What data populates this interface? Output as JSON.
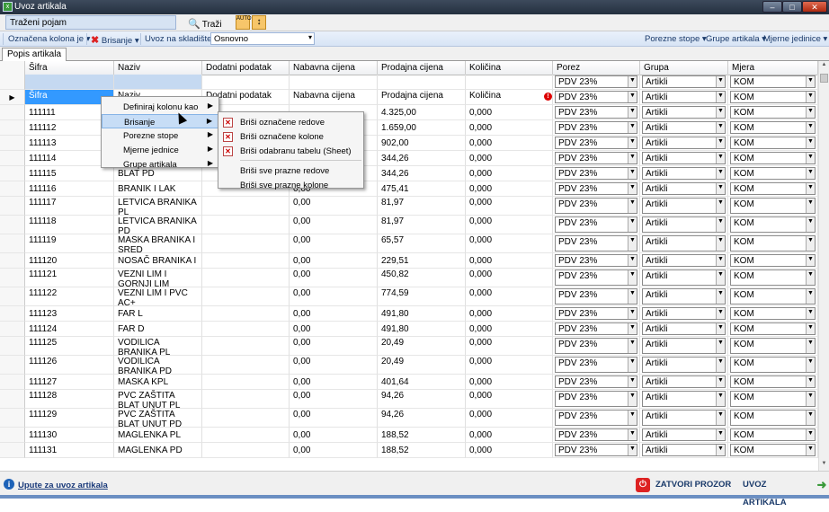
{
  "window": {
    "title": "Uvoz artikala",
    "min": "–",
    "max": "□",
    "close": "✕",
    "app_icon": "excel-icon"
  },
  "search": {
    "placeholder": "Traženi pojam",
    "button": "Traži",
    "tb1": "AUTO",
    "tb2": "↕"
  },
  "toolbar": {
    "oznacena_kolona": "Označena kolona je ▾",
    "brisanje": "Brisanje ▾",
    "uvoz_na_skladiste": "Uvoz na skladište :",
    "skladiste_value": "Osnovno",
    "porezne_stope": "Porezne stope ▾",
    "grupe_artikala": "Grupe artikala ▾",
    "mjerne_jedinice": "Mjerne jedinice ▾"
  },
  "tab": "Popis artikala",
  "columns": [
    "Šifra",
    "Naziv",
    "Dodatni podatak",
    "Nabavna cijena",
    "Prodajna cijena",
    "Količina",
    "Porez",
    "Grupa",
    "Mjera"
  ],
  "blank_row": {
    "porez": "PDV 23%",
    "grupa": "Artikli",
    "mjera": "KOM"
  },
  "header_row": [
    "Šifra",
    "Naziv",
    "Dodatni podatak",
    "Nabavna cijena",
    "Prodajna cijena",
    "Količina",
    "PDV 23%",
    "Artikli",
    "KOM"
  ],
  "rows": [
    {
      "sifra": "111111",
      "naziv": "",
      "dodatni": "",
      "nabavna": "",
      "prodajna": "4.325,00",
      "kolicina": "0,000",
      "porez": "PDV 23%",
      "grupa": "Artikli",
      "mjera": "KOM"
    },
    {
      "sifra": "111112",
      "naziv": "",
      "dodatni": "",
      "nabavna": "",
      "prodajna": "1.659,00",
      "kolicina": "0,000",
      "porez": "PDV 23%",
      "grupa": "Artikli",
      "mjera": "KOM"
    },
    {
      "sifra": "111113",
      "naziv": "",
      "dodatni": "",
      "nabavna": "",
      "prodajna": "902,00",
      "kolicina": "0,000",
      "porez": "PDV 23%",
      "grupa": "Artikli",
      "mjera": "KOM"
    },
    {
      "sifra": "111114",
      "naziv": "",
      "dodatni": "",
      "nabavna": "",
      "prodajna": "344,26",
      "kolicina": "0,000",
      "porez": "PDV 23%",
      "grupa": "Artikli",
      "mjera": "KOM"
    },
    {
      "sifra": "111115",
      "naziv": "BLAT PD",
      "dodatni": "",
      "nabavna": "",
      "prodajna": "344,26",
      "kolicina": "0,000",
      "porez": "PDV 23%",
      "grupa": "Artikli",
      "mjera": "KOM"
    },
    {
      "sifra": "111116",
      "naziv": "BRANIK I LAK",
      "dodatni": "",
      "nabavna": "0,00",
      "prodajna": "475,41",
      "kolicina": "0,000",
      "porez": "PDV 23%",
      "grupa": "Artikli",
      "mjera": "KOM"
    },
    {
      "sifra": "111117",
      "naziv": "LETVICA BRANIKA PL",
      "dodatni": "",
      "nabavna": "0,00",
      "prodajna": "81,97",
      "kolicina": "0,000",
      "porez": "PDV 23%",
      "grupa": "Artikli",
      "mjera": "KOM"
    },
    {
      "sifra": "111118",
      "naziv": "LETVICA BRANIKA PD",
      "dodatni": "",
      "nabavna": "0,00",
      "prodajna": "81,97",
      "kolicina": "0,000",
      "porez": "PDV 23%",
      "grupa": "Artikli",
      "mjera": "KOM"
    },
    {
      "sifra": "111119",
      "naziv": "MASKA BRANIKA I SRED",
      "dodatni": "",
      "nabavna": "0,00",
      "prodajna": "65,57",
      "kolicina": "0,000",
      "porez": "PDV 23%",
      "grupa": "Artikli",
      "mjera": "KOM"
    },
    {
      "sifra": "111120",
      "naziv": "NOSAČ BRANIKA I",
      "dodatni": "",
      "nabavna": "0,00",
      "prodajna": "229,51",
      "kolicina": "0,000",
      "porez": "PDV 23%",
      "grupa": "Artikli",
      "mjera": "KOM"
    },
    {
      "sifra": "111121",
      "naziv": "VEZNI LIM I GORNJI LIM",
      "dodatni": "",
      "nabavna": "0,00",
      "prodajna": "450,82",
      "kolicina": "0,000",
      "porez": "PDV 23%",
      "grupa": "Artikli",
      "mjera": "KOM"
    },
    {
      "sifra": "111122",
      "naziv": "VEZNI LIM I PVC AC+",
      "dodatni": "",
      "nabavna": "0,00",
      "prodajna": "774,59",
      "kolicina": "0,000",
      "porez": "PDV 23%",
      "grupa": "Artikli",
      "mjera": "KOM"
    },
    {
      "sifra": "111123",
      "naziv": "FAR L",
      "dodatni": "",
      "nabavna": "0,00",
      "prodajna": "491,80",
      "kolicina": "0,000",
      "porez": "PDV 23%",
      "grupa": "Artikli",
      "mjera": "KOM"
    },
    {
      "sifra": "111124",
      "naziv": "FAR D",
      "dodatni": "",
      "nabavna": "0,00",
      "prodajna": "491,80",
      "kolicina": "0,000",
      "porez": "PDV 23%",
      "grupa": "Artikli",
      "mjera": "KOM"
    },
    {
      "sifra": "111125",
      "naziv": "VODILICA BRANIKA PL",
      "dodatni": "",
      "nabavna": "0,00",
      "prodajna": "20,49",
      "kolicina": "0,000",
      "porez": "PDV 23%",
      "grupa": "Artikli",
      "mjera": "KOM"
    },
    {
      "sifra": "111126",
      "naziv": "VODILICA BRANIKA PD",
      "dodatni": "",
      "nabavna": "0,00",
      "prodajna": "20,49",
      "kolicina": "0,000",
      "porez": "PDV 23%",
      "grupa": "Artikli",
      "mjera": "KOM"
    },
    {
      "sifra": "111127",
      "naziv": "MASKA KPL",
      "dodatni": "",
      "nabavna": "0,00",
      "prodajna": "401,64",
      "kolicina": "0,000",
      "porez": "PDV 23%",
      "grupa": "Artikli",
      "mjera": "KOM"
    },
    {
      "sifra": "111128",
      "naziv": "PVC ZAŠTITA BLAT UNUT PL",
      "dodatni": "",
      "nabavna": "0,00",
      "prodajna": "94,26",
      "kolicina": "0,000",
      "porez": "PDV 23%",
      "grupa": "Artikli",
      "mjera": "KOM"
    },
    {
      "sifra": "111129",
      "naziv": "PVC ZAŠTITA BLAT UNUT PD",
      "dodatni": "",
      "nabavna": "0,00",
      "prodajna": "94,26",
      "kolicina": "0,000",
      "porez": "PDV 23%",
      "grupa": "Artikli",
      "mjera": "KOM"
    },
    {
      "sifra": "111130",
      "naziv": "MAGLENKA PL",
      "dodatni": "",
      "nabavna": "0,00",
      "prodajna": "188,52",
      "kolicina": "0,000",
      "porez": "PDV 23%",
      "grupa": "Artikli",
      "mjera": "KOM"
    },
    {
      "sifra": "111131",
      "naziv": "MAGLENKA PD",
      "dodatni": "",
      "nabavna": "0,00",
      "prodajna": "188,52",
      "kolicina": "0,000",
      "porez": "PDV 23%",
      "grupa": "Artikli",
      "mjera": "KOM"
    }
  ],
  "context_menu": [
    "Definiraj kolonu kao",
    "Brisanje",
    "Porezne stope",
    "Mjerne jednice",
    "Grupe artikala"
  ],
  "submenu": [
    "Briši označene redove",
    "Briši označene kolone",
    "Briši odabranu tabelu (Sheet)",
    "Briši sve prazne redove",
    "Briši sve prazne kolone"
  ],
  "bottom": {
    "upute": "Upute za uvoz artikala",
    "zatvori": "ZATVORI PROZOR",
    "uvoz": "UVOZ ARTIKALA"
  },
  "colors": {
    "accent": "#3399ff",
    "header_blue": "#c5d9f1",
    "close_red": "#dd2222"
  }
}
